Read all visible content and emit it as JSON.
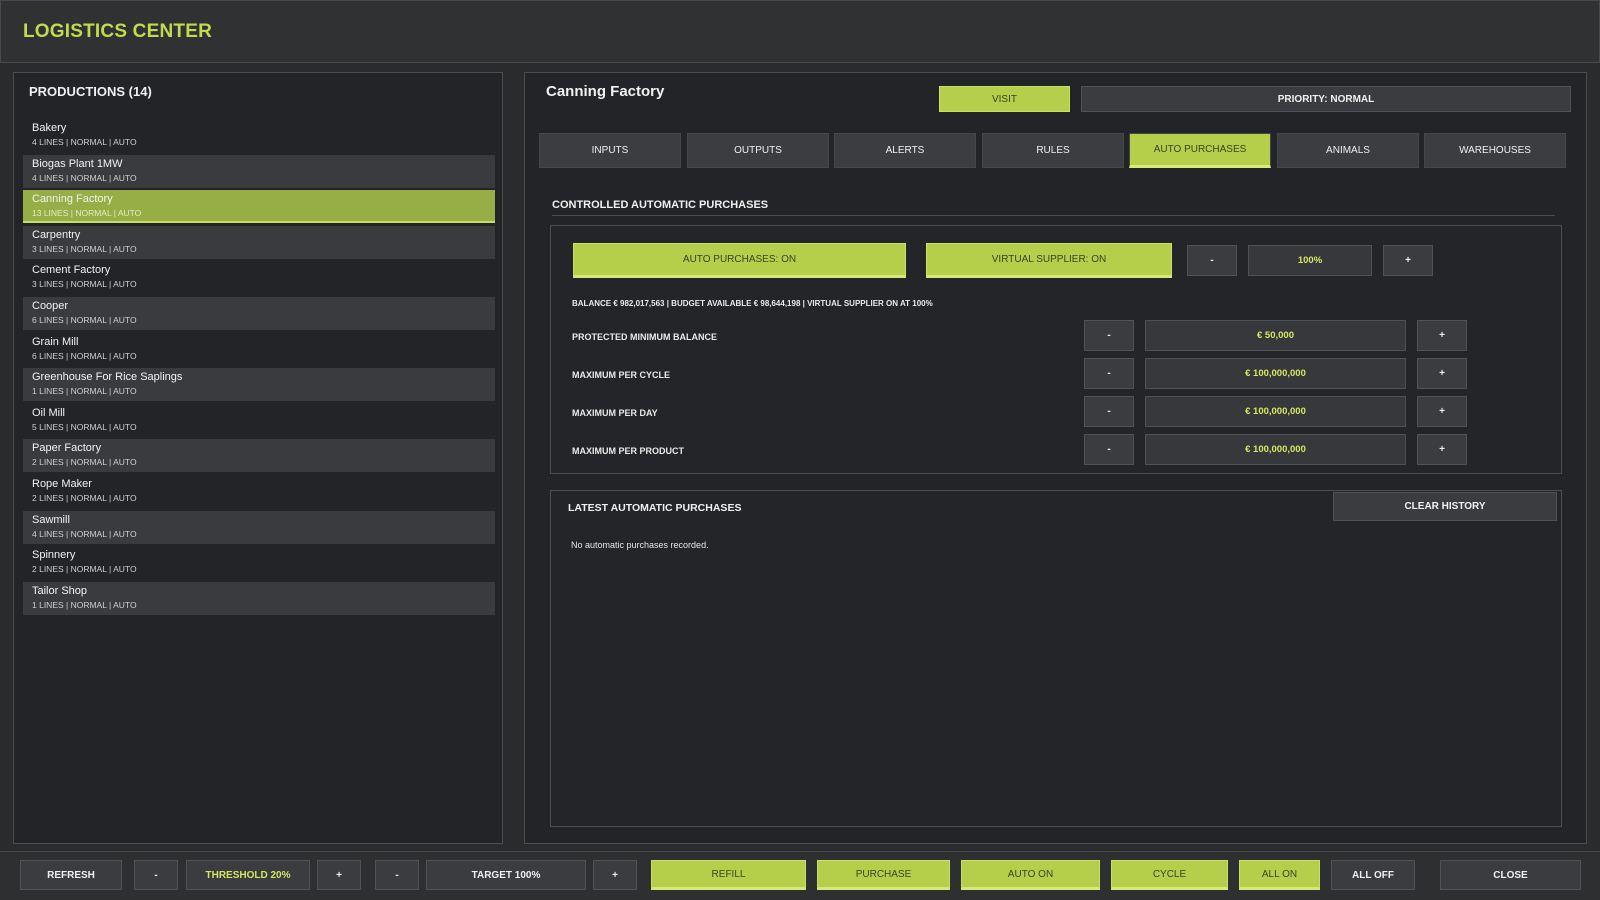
{
  "app": {
    "title": "LOGISTICS CENTER"
  },
  "productions": {
    "title": "PRODUCTIONS (14)",
    "items": [
      {
        "name": "Bakery",
        "info": "4 LINES | NORMAL | AUTO"
      },
      {
        "name": "Biogas Plant 1MW",
        "info": "4 LINES | NORMAL | AUTO"
      },
      {
        "name": "Canning Factory",
        "info": "13 LINES | NORMAL | AUTO"
      },
      {
        "name": "Carpentry",
        "info": "3 LINES | NORMAL | AUTO"
      },
      {
        "name": "Cement Factory",
        "info": "3 LINES | NORMAL | AUTO"
      },
      {
        "name": "Cooper",
        "info": "6 LINES | NORMAL | AUTO"
      },
      {
        "name": "Grain Mill",
        "info": "6 LINES | NORMAL | AUTO"
      },
      {
        "name": "Greenhouse For Rice Saplings",
        "info": "1 LINES | NORMAL | AUTO"
      },
      {
        "name": "Oil Mill",
        "info": "5 LINES | NORMAL | AUTO"
      },
      {
        "name": "Paper Factory",
        "info": "2 LINES | NORMAL | AUTO"
      },
      {
        "name": "Rope Maker",
        "info": "2 LINES | NORMAL | AUTO"
      },
      {
        "name": "Sawmill",
        "info": "4 LINES | NORMAL | AUTO"
      },
      {
        "name": "Spinnery",
        "info": "2 LINES | NORMAL | AUTO"
      },
      {
        "name": "Tailor Shop",
        "info": "1 LINES | NORMAL | AUTO"
      }
    ]
  },
  "detail": {
    "title": "Canning Factory",
    "visit_label": "VISIT",
    "priority_label": "PRIORITY: NORMAL",
    "tabs": [
      "INPUTS",
      "OUTPUTS",
      "ALERTS",
      "RULES",
      "AUTO PURCHASES",
      "ANIMALS",
      "WAREHOUSES"
    ],
    "active_tab": "AUTO PURCHASES"
  },
  "auto_purchases": {
    "section_title": "CONTROLLED AUTOMATIC PURCHASES",
    "auto_toggle_label": "AUTO PURCHASES: ON",
    "virtual_supplier_label": "VIRTUAL SUPPLIER: ON",
    "minus": "-",
    "plus": "+",
    "supplier_percent": "100%",
    "balance_line": "BALANCE € 982,017,563 | BUDGET AVAILABLE € 98,644,198 | VIRTUAL SUPPLIER ON AT 100%",
    "rows": [
      {
        "label": "PROTECTED MINIMUM BALANCE",
        "value": "€ 50,000"
      },
      {
        "label": "MAXIMUM PER CYCLE",
        "value": "€ 100,000,000"
      },
      {
        "label": "MAXIMUM PER DAY",
        "value": "€ 100,000,000"
      },
      {
        "label": "MAXIMUM PER PRODUCT",
        "value": "€ 100,000,000"
      }
    ]
  },
  "latest": {
    "title": "LATEST AUTOMATIC PURCHASES",
    "clear_label": "CLEAR HISTORY",
    "empty_text": "No automatic purchases recorded."
  },
  "footer": {
    "refresh": "REFRESH",
    "minus": "-",
    "plus": "+",
    "threshold": "THRESHOLD 20%",
    "target": "TARGET 100%",
    "refill": "REFILL",
    "purchase": "PURCHASE",
    "auto_on": "AUTO ON",
    "cycle": "CYCLE",
    "all_on": "ALL ON",
    "all_off": "ALL OFF",
    "close": "CLOSE"
  },
  "colors": {
    "accent": "#b5cf4b",
    "accent_text": "#c3d94e",
    "background": "#2a2b2d",
    "panel": "#232427"
  }
}
